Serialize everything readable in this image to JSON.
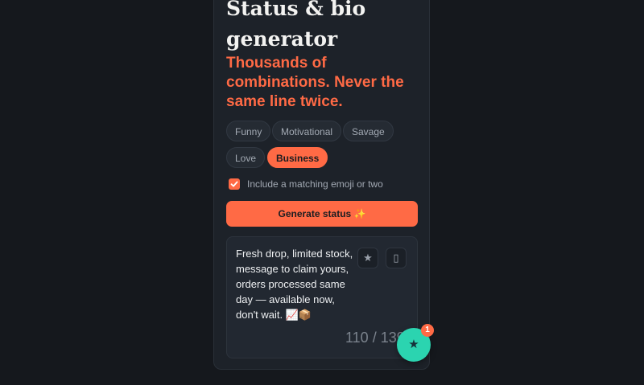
{
  "header": {
    "title": "Status & bio generator",
    "subtitle": "Thousands of combinations. Never the same line twice."
  },
  "categories": [
    {
      "label": "Funny",
      "active": false
    },
    {
      "label": "Motivational",
      "active": false
    },
    {
      "label": "Savage",
      "active": false
    },
    {
      "label": "Love",
      "active": false
    },
    {
      "label": "Business",
      "active": true
    }
  ],
  "options": {
    "emoji_label": "Include a matching emoji or two",
    "emoji_checked": true
  },
  "generate": {
    "label": "Generate status ✨"
  },
  "result": {
    "text": "Fresh drop, limited stock, message to claim yours, orders processed same day — available now, don't wait. 📈📦",
    "favorite_icon": "★",
    "copy_icon": "▯",
    "counter": "110 / 139"
  },
  "fab": {
    "icon": "★",
    "badge": "1"
  },
  "colors": {
    "accent": "#ff6a45",
    "fab": "#2bd4b0",
    "background": "#15181d",
    "card": "#1d2229"
  }
}
